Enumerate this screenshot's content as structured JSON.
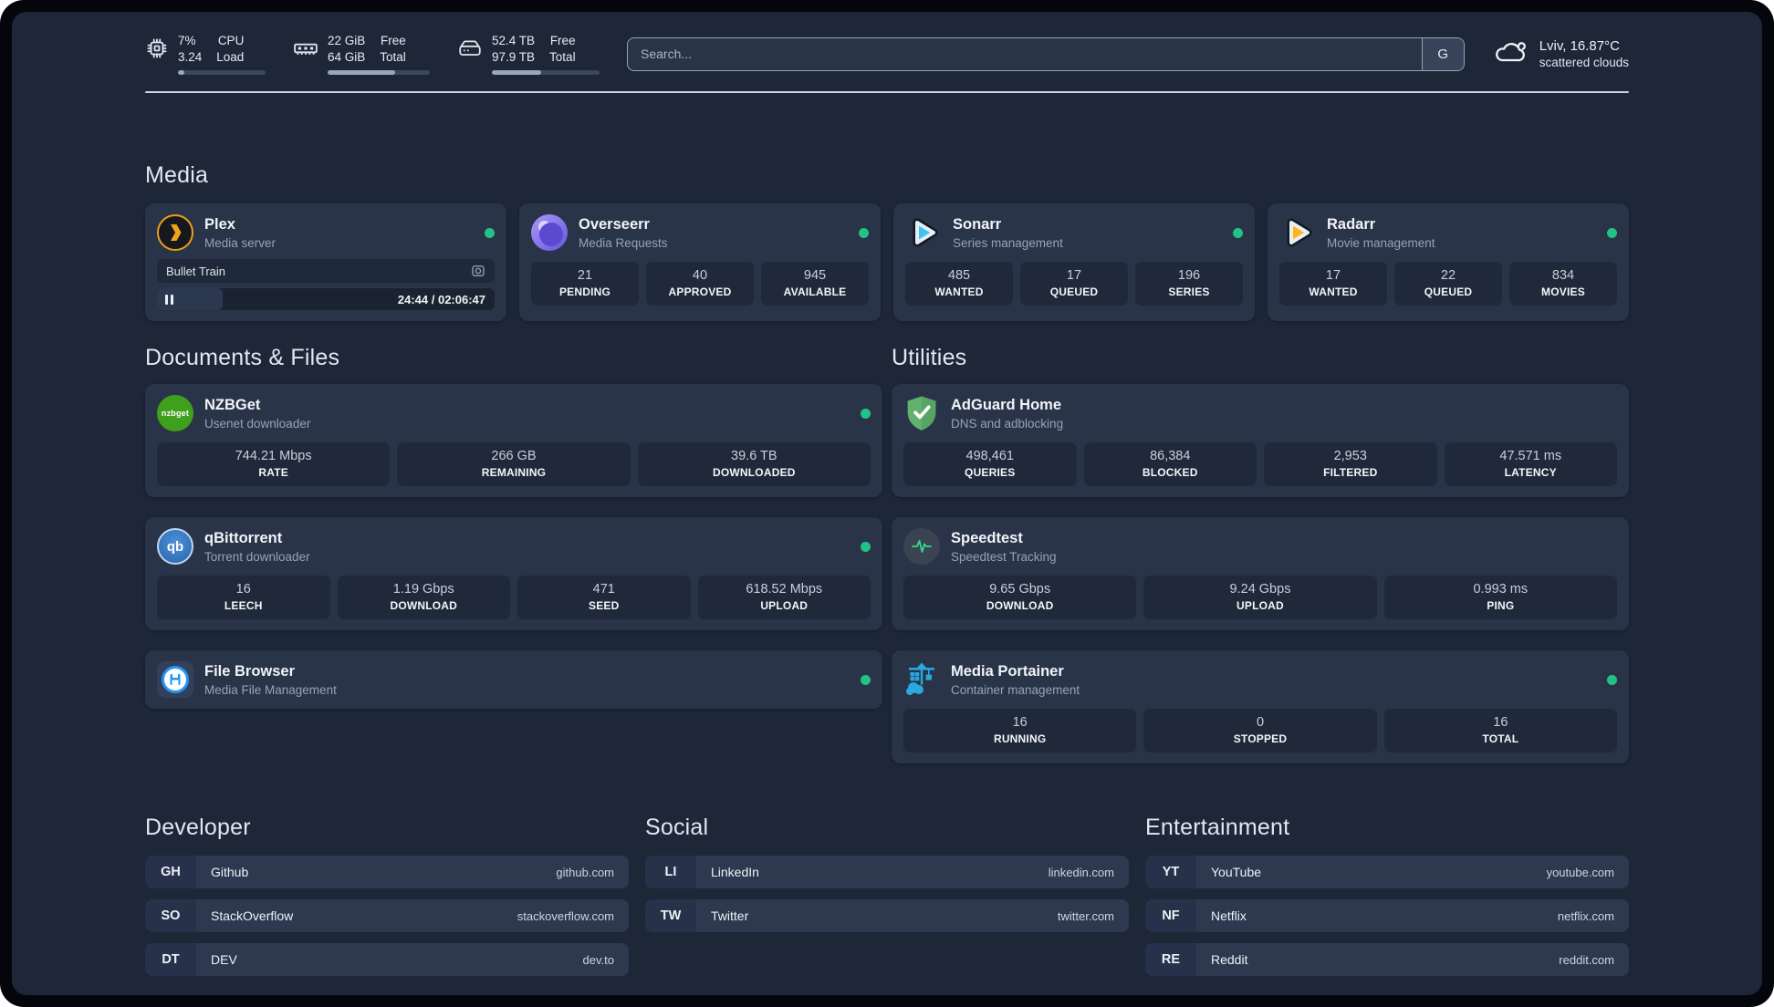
{
  "header": {
    "metrics": [
      {
        "name": "cpu",
        "col1_top": "7%",
        "col1_bottom": "3.24",
        "col2_top": "CPU",
        "col2_bottom": "Load",
        "percent": 7
      },
      {
        "name": "memory",
        "col1_top": "22 GiB",
        "col1_bottom": "64 GiB",
        "col2_top": "Free",
        "col2_bottom": "Total",
        "percent": 66
      },
      {
        "name": "disk",
        "col1_top": "52.4 TB",
        "col1_bottom": "97.9 TB",
        "col2_top": "Free",
        "col2_bottom": "Total",
        "percent": 46
      }
    ],
    "search": {
      "placeholder": "Search...",
      "button_label": "G"
    },
    "weather": {
      "location": "Lviv, 16.87°C",
      "condition": "scattered clouds"
    }
  },
  "sections": {
    "media": {
      "title": "Media",
      "cards": {
        "plex": {
          "title": "Plex",
          "subtitle": "Media server",
          "online": true,
          "now_playing": {
            "title": "Bullet Train",
            "time_display": "24:44 / 02:06:47",
            "progress_percent": 19.5
          }
        },
        "overseerr": {
          "title": "Overseerr",
          "subtitle": "Media Requests",
          "online": true,
          "stats": [
            {
              "value": "21",
              "label": "PENDING"
            },
            {
              "value": "40",
              "label": "APPROVED"
            },
            {
              "value": "945",
              "label": "AVAILABLE"
            }
          ]
        },
        "sonarr": {
          "title": "Sonarr",
          "subtitle": "Series management",
          "online": true,
          "stats": [
            {
              "value": "485",
              "label": "WANTED"
            },
            {
              "value": "17",
              "label": "QUEUED"
            },
            {
              "value": "196",
              "label": "SERIES"
            }
          ]
        },
        "radarr": {
          "title": "Radarr",
          "subtitle": "Movie management",
          "online": true,
          "stats": [
            {
              "value": "17",
              "label": "WANTED"
            },
            {
              "value": "22",
              "label": "QUEUED"
            },
            {
              "value": "834",
              "label": "MOVIES"
            }
          ]
        }
      }
    },
    "documents": {
      "title": "Documents & Files",
      "cards": {
        "nzbget": {
          "title": "NZBGet",
          "subtitle": "Usenet downloader",
          "online": true,
          "stats": [
            {
              "value": "744.21 Mbps",
              "label": "RATE"
            },
            {
              "value": "266 GB",
              "label": "REMAINING"
            },
            {
              "value": "39.6 TB",
              "label": "DOWNLOADED"
            }
          ]
        },
        "qbittorrent": {
          "title": "qBittorrent",
          "subtitle": "Torrent downloader",
          "online": true,
          "stats": [
            {
              "value": "16",
              "label": "LEECH"
            },
            {
              "value": "1.19 Gbps",
              "label": "DOWNLOAD"
            },
            {
              "value": "471",
              "label": "SEED"
            },
            {
              "value": "618.52 Mbps",
              "label": "UPLOAD"
            }
          ]
        },
        "filebrowser": {
          "title": "File Browser",
          "subtitle": "Media File Management",
          "online": true
        }
      }
    },
    "utilities": {
      "title": "Utilities",
      "cards": {
        "adguard": {
          "title": "AdGuard Home",
          "subtitle": "DNS and adblocking",
          "stats": [
            {
              "value": "498,461",
              "label": "QUERIES"
            },
            {
              "value": "86,384",
              "label": "BLOCKED"
            },
            {
              "value": "2,953",
              "label": "FILTERED"
            },
            {
              "value": "47.571 ms",
              "label": "LATENCY"
            }
          ]
        },
        "speedtest": {
          "title": "Speedtest",
          "subtitle": "Speedtest Tracking",
          "stats": [
            {
              "value": "9.65 Gbps",
              "label": "DOWNLOAD"
            },
            {
              "value": "9.24 Gbps",
              "label": "UPLOAD"
            },
            {
              "value": "0.993 ms",
              "label": "PING"
            }
          ]
        },
        "portainer": {
          "title": "Media Portainer",
          "subtitle": "Container management",
          "online": true,
          "stats": [
            {
              "value": "16",
              "label": "RUNNING"
            },
            {
              "value": "0",
              "label": "STOPPED"
            },
            {
              "value": "16",
              "label": "TOTAL"
            }
          ]
        }
      }
    },
    "bookmarks": [
      {
        "title": "Developer",
        "links": [
          {
            "abbr": "GH",
            "name": "Github",
            "url": "github.com"
          },
          {
            "abbr": "SO",
            "name": "StackOverflow",
            "url": "stackoverflow.com"
          },
          {
            "abbr": "DT",
            "name": "DEV",
            "url": "dev.to"
          }
        ]
      },
      {
        "title": "Social",
        "links": [
          {
            "abbr": "LI",
            "name": "LinkedIn",
            "url": "linkedin.com"
          },
          {
            "abbr": "TW",
            "name": "Twitter",
            "url": "twitter.com"
          }
        ]
      },
      {
        "title": "Entertainment",
        "links": [
          {
            "abbr": "YT",
            "name": "YouTube",
            "url": "youtube.com"
          },
          {
            "abbr": "NF",
            "name": "Netflix",
            "url": "netflix.com"
          },
          {
            "abbr": "RE",
            "name": "Reddit",
            "url": "reddit.com"
          }
        ]
      }
    ]
  },
  "icons": {
    "nzbget_label": "nzbget",
    "qbittorrent_label": "qb"
  },
  "colors": {
    "background": "#1d2737",
    "card": "#2a3448",
    "stat_pill": "#1f2939",
    "accent_green": "#22c287",
    "plex_amber": "#e8a116",
    "sonarr_blue": "#3ec1f3",
    "radarr_yellow": "#ffb41f",
    "nzbget_green": "#3fa01e",
    "adguard_green": "#63b16e",
    "portainer_blue": "#29a8e0",
    "filebrowser_blue": "#2196f3"
  }
}
